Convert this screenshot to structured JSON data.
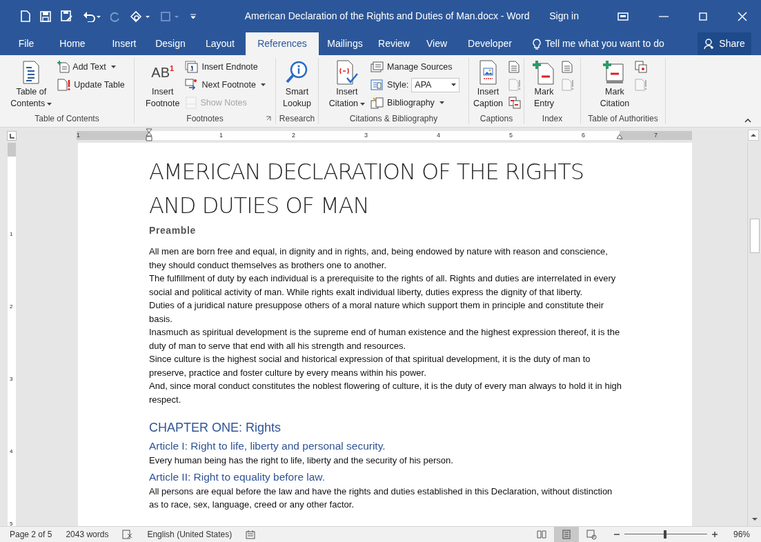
{
  "window": {
    "title": "American Declaration of the Rights and Duties of Man.docx - Word",
    "sign_in": "Sign in"
  },
  "tabs": [
    {
      "label": "File",
      "selected": false
    },
    {
      "label": "Home",
      "selected": false
    },
    {
      "label": "Insert",
      "selected": false
    },
    {
      "label": "Design",
      "selected": false
    },
    {
      "label": "Layout",
      "selected": false
    },
    {
      "label": "References",
      "selected": true
    },
    {
      "label": "Mailings",
      "selected": false
    },
    {
      "label": "Review",
      "selected": false
    },
    {
      "label": "View",
      "selected": false
    },
    {
      "label": "Developer",
      "selected": false
    }
  ],
  "tell_me": {
    "placeholder": "Tell me what you want to do"
  },
  "share": "Share",
  "ribbon": [
    {
      "label": "Table of Contents",
      "launcher": false,
      "columns": [
        [
          {
            "kind": "large",
            "lines": [
              "Table of",
              "Contents"
            ],
            "dropdown": true,
            "disabled": false
          }
        ],
        [
          {
            "kind": "small",
            "label": "Add Text",
            "dropdown": true,
            "disabled": false
          },
          {
            "kind": "small",
            "label": "Update Table",
            "dropdown": false,
            "disabled": false
          }
        ]
      ]
    },
    {
      "label": "Footnotes",
      "launcher": true,
      "columns": [
        [
          {
            "kind": "large",
            "icon_text": "AB",
            "icon_superscript": "1",
            "lines": [
              "Insert",
              "Footnote"
            ],
            "dropdown": false,
            "disabled": false
          }
        ],
        [
          {
            "kind": "small",
            "label": "Insert Endnote",
            "dropdown": false,
            "disabled": false
          },
          {
            "kind": "small",
            "label": "Next Footnote",
            "dropdown": true,
            "disabled": false
          },
          {
            "kind": "small",
            "label": "Show Notes",
            "dropdown": false,
            "disabled": true
          }
        ]
      ]
    },
    {
      "label": "Research",
      "launcher": false,
      "columns": [
        [
          {
            "kind": "large",
            "lines": [
              "Smart",
              "Lookup"
            ],
            "dropdown": false,
            "disabled": false
          }
        ]
      ]
    },
    {
      "label": "Citations & Bibliography",
      "launcher": false,
      "columns": [
        [
          {
            "kind": "large",
            "lines": [
              "Insert",
              "Citation"
            ],
            "dropdown": true,
            "disabled": false
          }
        ],
        [
          {
            "kind": "small",
            "label": "Manage Sources",
            "dropdown": false,
            "disabled": false
          },
          {
            "kind": "combo",
            "label": "Style:",
            "value": "APA",
            "dropdown": true,
            "disabled": false
          },
          {
            "kind": "small",
            "label": "Bibliography",
            "dropdown": true,
            "disabled": false
          }
        ]
      ]
    },
    {
      "label": "Captions",
      "launcher": false,
      "columns": [
        [
          {
            "kind": "large",
            "lines": [
              "Insert",
              "Caption"
            ],
            "dropdown": false,
            "disabled": false
          }
        ],
        [
          {
            "kind": "icon",
            "disabled": false
          },
          {
            "kind": "icon",
            "disabled": true
          },
          {
            "kind": "icon",
            "disabled": false
          }
        ]
      ]
    },
    {
      "label": "Index",
      "launcher": false,
      "columns": [
        [
          {
            "kind": "large",
            "lines": [
              "Mark",
              "Entry"
            ],
            "dropdown": false,
            "disabled": false
          }
        ],
        [
          {
            "kind": "icon",
            "disabled": false
          },
          {
            "kind": "icon",
            "disabled": true
          }
        ]
      ]
    },
    {
      "label": "Table of Authorities",
      "launcher": false,
      "columns": [
        [
          {
            "kind": "large",
            "lines": [
              "Mark",
              "Citation"
            ],
            "dropdown": false,
            "disabled": false
          }
        ],
        [
          {
            "kind": "icon",
            "disabled": false
          },
          {
            "kind": "icon",
            "disabled": true
          }
        ]
      ]
    }
  ],
  "ruler": {
    "numbers": [
      "1",
      "1",
      "2",
      "3",
      "4",
      "5",
      "6",
      "7"
    ]
  },
  "vertical_ruler": {
    "numbers": [
      "1",
      "2",
      "3",
      "4",
      "5"
    ]
  },
  "document": {
    "title": "AMERICAN DECLARATION OF THE RIGHTS AND DUTIES OF MAN",
    "subtitle": "Preamble",
    "paragraphs": [
      "All men are born free and equal, in dignity and in rights, and, being endowed by nature with reason and conscience, they should conduct themselves as brothers one to another.",
      "The fulfillment of duty by each individual is a prerequisite to the rights of all. Rights and duties are interrelated in every social and political activity of man. While rights exalt individual liberty, duties express the dignity of that liberty.",
      "Duties of a juridical nature presuppose others of a moral nature which support them in principle and constitute their basis.",
      "Inasmuch as spiritual development is the supreme end of human existence and the highest expression thereof, it is the duty of man to serve that end with all his strength and resources.",
      "Since culture is the highest social and historical expression of that spiritual development, it is the duty of man to preserve, practice and foster culture by every means within his power.",
      "And, since moral conduct constitutes the noblest flowering of culture, it is the duty of every man always to hold it in high respect."
    ],
    "chapter": "CHAPTER ONE: Rights",
    "articles": [
      {
        "heading": "Article I: Right to life, liberty and personal security.",
        "text": "Every human being has the right to life, liberty and the security of his person."
      },
      {
        "heading": "Article II: Right to equality before law.",
        "text": "All persons are equal before the law and have the rights and duties established in this Declaration, without distinction as to race, sex, language, creed or any other factor."
      }
    ]
  },
  "status_bar": {
    "page": "Page 2 of 5",
    "words": "2043 words",
    "language": "English (United States)",
    "zoom": "96%",
    "zoom_slider": {
      "level": 0.49
    },
    "views": [
      {
        "kind": "read",
        "selected": false
      },
      {
        "kind": "print",
        "selected": true
      },
      {
        "kind": "web",
        "selected": false
      }
    ]
  }
}
